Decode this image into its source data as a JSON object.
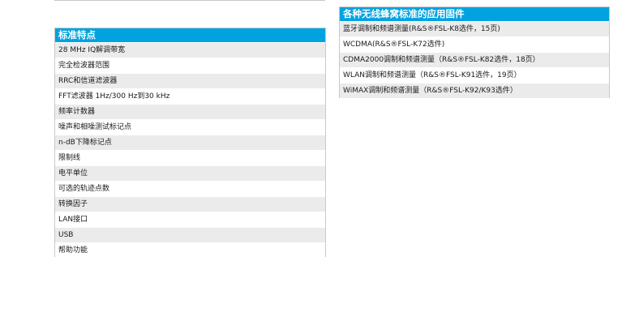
{
  "left_table": {
    "title": "标准特点",
    "rows": [
      "28 MHz IQ解调带宽",
      "完全检波器范围",
      "RRC和信道滤波器",
      "FFT滤波器 1Hz/300 Hz到30 kHz",
      "频率计数器",
      "噪声和相噪测试标记点",
      "n-dB下降标记点",
      "限制线",
      "电平单位",
      "可选的轨迹点数",
      "转换因子",
      "LAN接口",
      "USB",
      "帮助功能"
    ]
  },
  "right_table": {
    "title": "各种无线蜂窝标准的应用固件",
    "rows": [
      "蓝牙调制和频谱测量(R&S®FSL-K8选件，15页)",
      "WCDMA(R&S®FSL-K72选件)",
      "CDMA2000调制和频谱测量（R&S®FSL-K82选件，18页）",
      "WLAN调制和频谱测量（R&S®FSL-K91选件，19页）",
      "WiMAX调制和频谱测量（R&S®FSL-K92/K93选件）"
    ]
  }
}
